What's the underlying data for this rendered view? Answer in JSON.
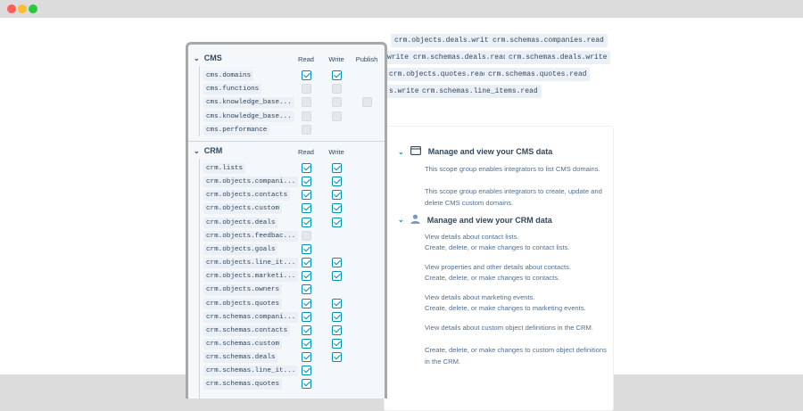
{
  "background_tags": [
    {
      "text": "crm.objects.deals.write"
    },
    {
      "text": "crm.schemas.companies.read"
    },
    {
      "text": "write"
    },
    {
      "text": "crm.schemas.deals.read"
    },
    {
      "text": "crm.schemas.deals.write"
    },
    {
      "text": "crm.objects.quotes.read"
    },
    {
      "text": "crm.schemas.quotes.read"
    },
    {
      "text": "s.write"
    },
    {
      "text": "crm.schemas.line_items.read"
    }
  ],
  "card": {
    "cms_heading": "Manage and view your CMS data",
    "cms_desc": [
      "This scope group enables integrators to list CMS domains.",
      "This scope group enables integrators to create, update and delete CMS custom domains."
    ],
    "crm_heading": "Manage and view your CRM data",
    "crm_desc": [
      "View details about contact lists.",
      "Create, delete, or make changes to contact lists.",
      "View properties and other details about contacts.",
      "Create, delete, or make changes to contacts.",
      "View details about marketing events.",
      "Create, delete, or make changes to marketing events.",
      "View details about custom object definitions in the CRM.",
      "Create, delete, or make changes to custom object definitions in the CRM."
    ]
  },
  "panel": {
    "cms": {
      "title": "CMS",
      "col_read": "Read",
      "col_write": "Write",
      "col_publish": "Publish",
      "rows": [
        {
          "scope": "cms.domains",
          "read": true,
          "write": true,
          "publish": null
        },
        {
          "scope": "cms.functions",
          "read": false,
          "write": false,
          "publish": null
        },
        {
          "scope": "cms.knowledge_base...",
          "read": false,
          "write": false,
          "publish": false
        },
        {
          "scope": "cms.knowledge_base...",
          "read": false,
          "write": false,
          "publish": null
        },
        {
          "scope": "cms.performance",
          "read": false,
          "write": null,
          "publish": null
        }
      ]
    },
    "crm": {
      "title": "CRM",
      "col_read": "Read",
      "col_write": "Write",
      "rows": [
        {
          "scope": "crm.lists",
          "read": true,
          "write": true
        },
        {
          "scope": "crm.objects.compani...",
          "read": true,
          "write": true
        },
        {
          "scope": "crm.objects.contacts",
          "read": true,
          "write": true
        },
        {
          "scope": "crm.objects.custom",
          "read": true,
          "write": true
        },
        {
          "scope": "crm.objects.deals",
          "read": true,
          "write": true
        },
        {
          "scope": "crm.objects.feedbac...",
          "read": false,
          "write": null
        },
        {
          "scope": "crm.objects.goals",
          "read": true,
          "write": null
        },
        {
          "scope": "crm.objects.line_it...",
          "read": true,
          "write": true
        },
        {
          "scope": "crm.objects.marketi...",
          "read": true,
          "write": true
        },
        {
          "scope": "crm.objects.owners",
          "read": true,
          "write": null
        },
        {
          "scope": "crm.objects.quotes",
          "read": true,
          "write": true
        },
        {
          "scope": "crm.schemas.compani...",
          "read": true,
          "write": true
        },
        {
          "scope": "crm.schemas.contacts",
          "read": true,
          "write": true
        },
        {
          "scope": "crm.schemas.custom",
          "read": true,
          "write": true
        },
        {
          "scope": "crm.schemas.deals",
          "read": true,
          "write": true
        },
        {
          "scope": "crm.schemas.line_it...",
          "read": true,
          "write": null
        },
        {
          "scope": "crm.schemas.quotes",
          "read": true,
          "write": null
        }
      ]
    }
  },
  "colors": {
    "accent": "#0091ae",
    "chip": "#eaf0f6",
    "text": "#33475b"
  }
}
